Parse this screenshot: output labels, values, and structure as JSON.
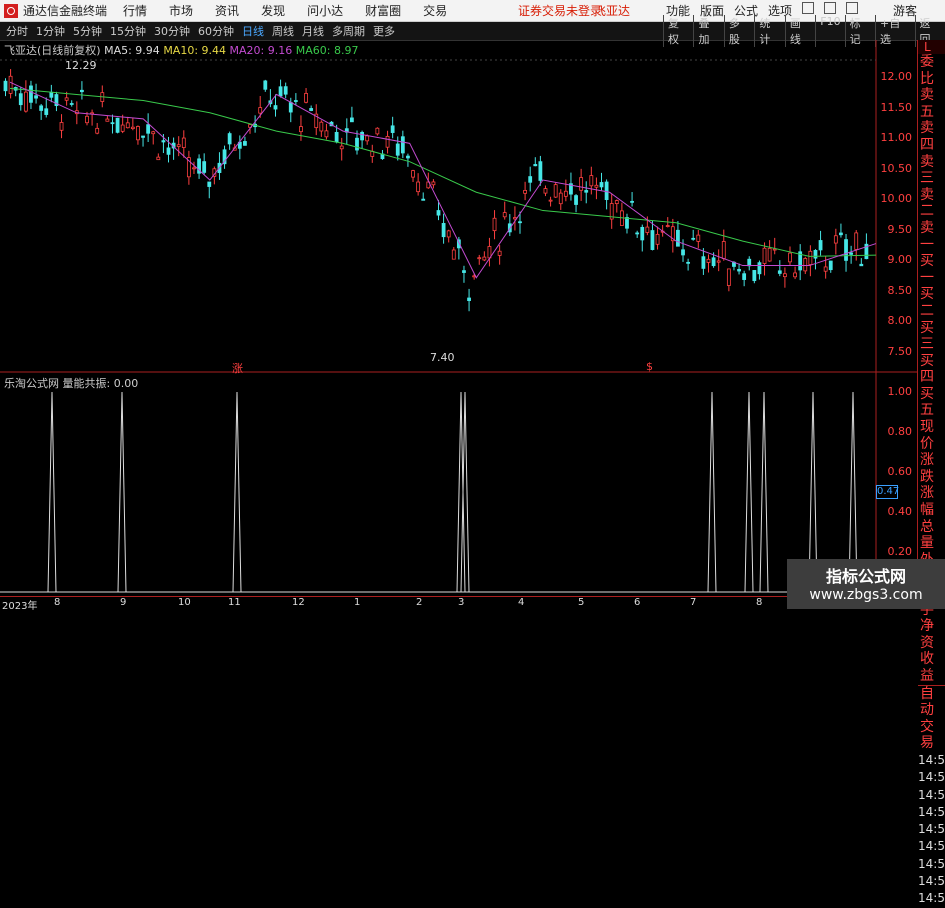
{
  "menubar": {
    "app_title": "通达信金融终端",
    "menus": [
      "行情",
      "市场",
      "资讯",
      "发现",
      "问小达",
      "财富圈",
      "交易"
    ],
    "warning": "证券交易未登录",
    "stock_name": "飞亚达",
    "right_menus": [
      "功能",
      "版面",
      "公式",
      "选项"
    ],
    "guest": "游客"
  },
  "toolbar": {
    "periods": [
      "分时",
      "1分钟",
      "5分钟",
      "15分钟",
      "30分钟",
      "60分钟",
      "日线",
      "周线",
      "月线",
      "多周期",
      "更多"
    ],
    "active_period": "日线",
    "tools": [
      "复权",
      "叠加",
      "多股",
      "统计",
      "画线",
      "F10",
      "标记",
      "+自选",
      "返回"
    ]
  },
  "main_info": {
    "title": "飞亚达(日线前复权)",
    "ma5": "MA5: 9.94",
    "ma10": "MA10: 9.44",
    "ma20": "MA20: 9.16",
    "ma60": "MA60: 8.97"
  },
  "chart_labels": {
    "high": "12.29",
    "low": "7.40",
    "up_mark": "涨",
    "s_mark": "$"
  },
  "price_axis": [
    "12.00",
    "11.50",
    "11.00",
    "10.50",
    "10.00",
    "9.50",
    "9.00",
    "8.50",
    "8.00",
    "7.50"
  ],
  "indicator": {
    "title": "乐淘公式网",
    "name": "量能共振: 0.00",
    "current": "0.47"
  },
  "indicator_axis": [
    "1.00",
    "0.80",
    "0.60",
    "0.40",
    "0.20"
  ],
  "right_panel": {
    "top": "L",
    "items": [
      "委比",
      "卖五",
      "卖四",
      "卖三",
      "卖二",
      "卖一",
      "买一",
      "买二",
      "买三",
      "买四",
      "买五",
      "现价",
      "涨跌",
      "涨幅",
      "总量",
      "外盘",
      "换手",
      "净资",
      "收益"
    ],
    "lower": [
      "自动",
      "交易"
    ],
    "times": [
      "14:55",
      "14:56",
      "14:56",
      "14:56",
      "14:56",
      "14:56",
      "14:56",
      "14:56",
      "14:56",
      "14:56",
      "14:56",
      "14:56"
    ]
  },
  "x_axis": [
    "2023年",
    "8",
    "9",
    "10",
    "11",
    "12",
    "1",
    "2",
    "3",
    "4",
    "5",
    "6",
    "7",
    "8"
  ],
  "watermark": {
    "line1": "指标公式网",
    "line2": "www.zbgs3.com"
  },
  "colors": {
    "up": "#ff4040",
    "down": "#46e6e6",
    "ma5": "#dddddd",
    "ma10": "#e6d845",
    "ma20": "#c34bd1",
    "ma60": "#39c94b"
  },
  "chart_data": {
    "type": "line",
    "title": "飞亚达(日线前复权)",
    "ylim": [
      7.3,
      12.3
    ],
    "series": [
      {
        "name": "MA60",
        "values": [
          11.7,
          11.6,
          11.5,
          11.3,
          11.0,
          10.8,
          10.5,
          10.0,
          9.7,
          9.6,
          9.5,
          9.2,
          8.95,
          8.97
        ]
      },
      {
        "name": "MA20",
        "values": [
          11.8,
          11.3,
          11.2,
          10.2,
          11.6,
          11.0,
          10.8,
          8.6,
          10.2,
          10.0,
          9.2,
          8.8,
          8.8,
          9.16
        ]
      }
    ],
    "x": [
      "2023-07",
      "2023-08",
      "2023-09",
      "2023-10",
      "2023-11",
      "2023-12",
      "2024-01",
      "2024-02",
      "2024-03",
      "2024-04",
      "2024-05",
      "2024-06",
      "2024-07",
      "2024-08"
    ],
    "indicator_spikes_x": [
      "2023-08",
      "2023-09",
      "2023-11",
      "2024-03",
      "2024-03",
      "2024-06",
      "2024-07",
      "2024-07",
      "2024-08",
      "2024-08",
      "2024-08"
    ]
  }
}
